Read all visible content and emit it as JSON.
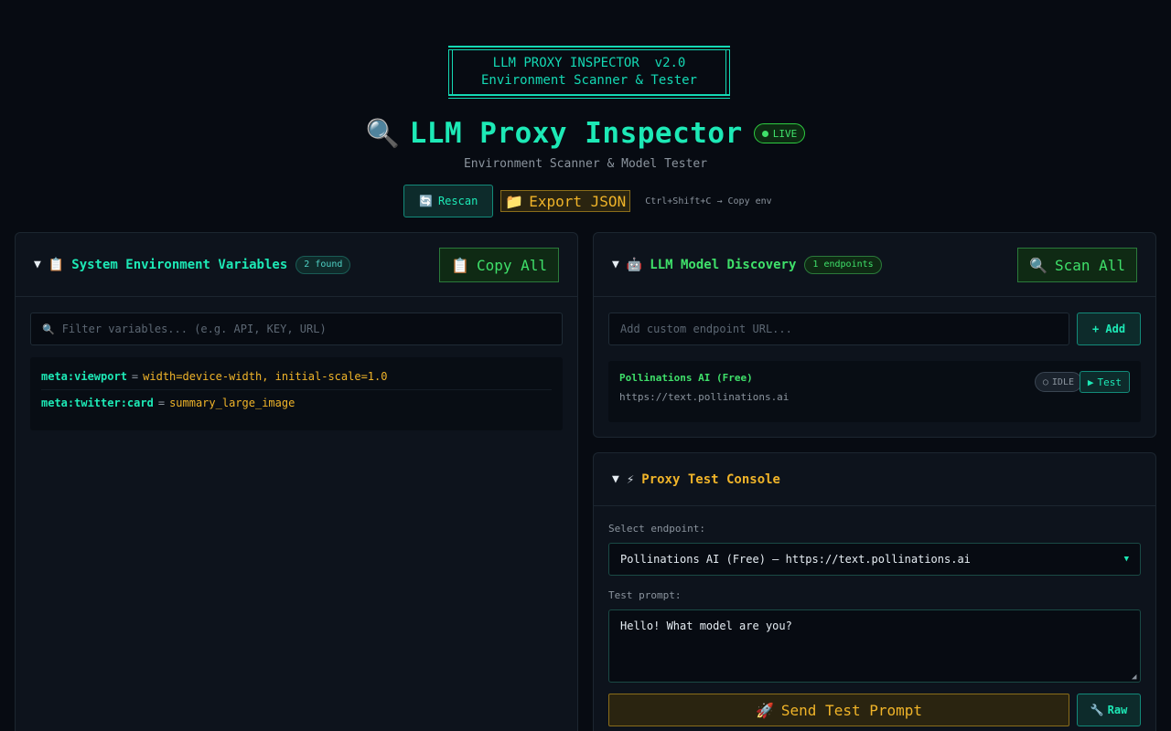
{
  "banner": {
    "line1": "LLM PROXY INSPECTOR  v2.0",
    "line2": "Environment Scanner & Tester"
  },
  "header": {
    "title_icon": "🔍",
    "title": "LLM Proxy Inspector",
    "live_label": "LIVE",
    "subtitle": "Environment Scanner & Model Tester"
  },
  "toolbar": {
    "rescan_icon": "🔄",
    "rescan_label": "Rescan",
    "export_icon": "📁",
    "export_label": "Export JSON",
    "shortcut_hint": "Ctrl+Shift+C → Copy env"
  },
  "env_panel": {
    "caret": "▼",
    "icon": "📋",
    "title": "System Environment Variables",
    "count": "2 found",
    "copy_icon": "📋",
    "copy_label": "Copy All",
    "filter_icon": "🔍",
    "filter_placeholder": "Filter variables... (e.g. API, KEY, URL)",
    "variables": [
      {
        "key": "meta:viewport",
        "eq": "=",
        "value": "width=device-width, initial-scale=1.0"
      },
      {
        "key": "meta:twitter:card",
        "eq": "=",
        "value": "summary_large_image"
      }
    ]
  },
  "llm_panel": {
    "caret": "▼",
    "icon": "🤖",
    "title": "LLM Model Discovery",
    "count": "1 endpoints",
    "scan_icon": "🔍",
    "scan_label": "Scan All",
    "endpoint_placeholder": "Add custom endpoint URL...",
    "add_label": "+ Add",
    "endpoint": {
      "name": "Pollinations AI (Free)",
      "url": "https://text.pollinations.ai",
      "status_icon": "○",
      "status": "IDLE",
      "test_icon": "▶",
      "test_label": "Test"
    }
  },
  "console_panel": {
    "caret": "▼",
    "icon": "⚡",
    "title": "Proxy Test Console",
    "select_label": "Select endpoint:",
    "selected_endpoint": "Pollinations AI (Free) — https://text.pollinations.ai",
    "prompt_label": "Test prompt:",
    "prompt_value": "Hello! What model are you?",
    "send_icon": "🚀",
    "send_label": "Send Test Prompt",
    "raw_icon": "🔧",
    "raw_label": "Raw"
  },
  "colors": {
    "accent_teal": "#1de9b6",
    "accent_green": "#3fe06a",
    "accent_amber": "#f0b429",
    "background": "#070b12"
  }
}
